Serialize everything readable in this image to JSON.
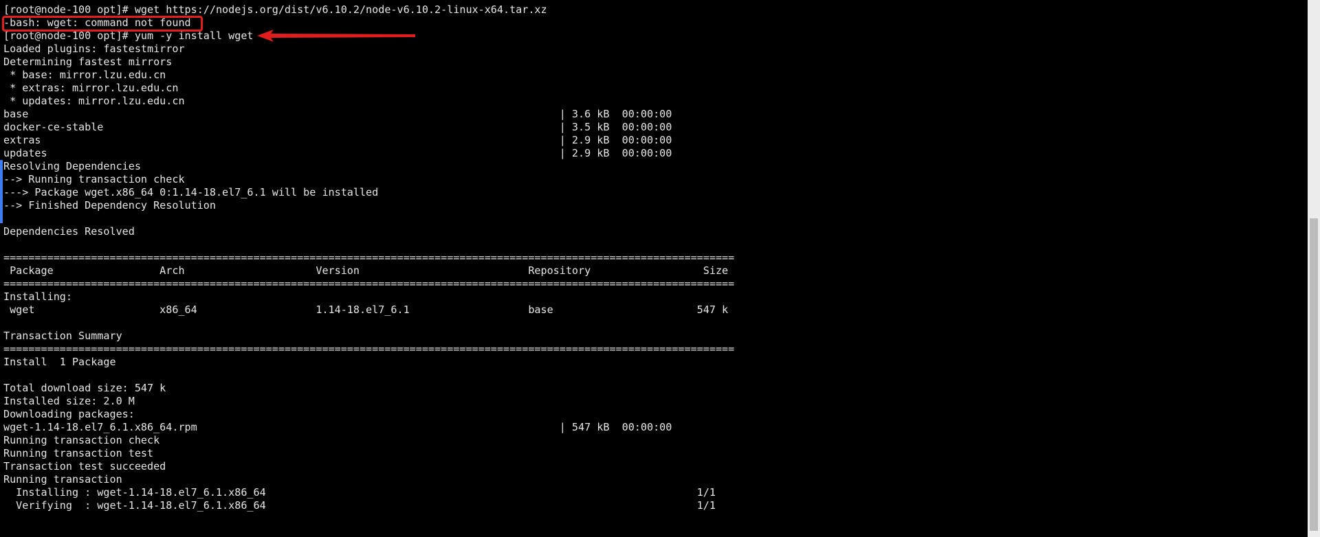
{
  "terminal": {
    "lines": [
      "[root@node-100 opt]# wget https://nodejs.org/dist/v6.10.2/node-v6.10.2-linux-x64.tar.xz",
      "-bash: wget: command not found",
      "[root@node-100 opt]# yum -y install wget",
      "Loaded plugins: fastestmirror",
      "Determining fastest mirrors",
      " * base: mirror.lzu.edu.cn",
      " * extras: mirror.lzu.edu.cn",
      " * updates: mirror.lzu.edu.cn",
      "base                                                                                     | 3.6 kB  00:00:00",
      "docker-ce-stable                                                                         | 3.5 kB  00:00:00",
      "extras                                                                                   | 2.9 kB  00:00:00",
      "updates                                                                                  | 2.9 kB  00:00:00",
      "Resolving Dependencies",
      "--> Running transaction check",
      "---> Package wget.x86_64 0:1.14-18.el7_6.1 will be installed",
      "--> Finished Dependency Resolution",
      "",
      "Dependencies Resolved",
      "",
      "=====================================================================================================================",
      " Package                 Arch                     Version                           Repository                  Size",
      "=====================================================================================================================",
      "Installing:",
      " wget                    x86_64                   1.14-18.el7_6.1                   base                       547 k",
      "",
      "Transaction Summary",
      "=====================================================================================================================",
      "Install  1 Package",
      "",
      "Total download size: 547 k",
      "Installed size: 2.0 M",
      "Downloading packages:",
      "wget-1.14-18.el7_6.1.x86_64.rpm                                                          | 547 kB  00:00:00",
      "Running transaction check",
      "Running transaction test",
      "Transaction test succeeded",
      "Running transaction",
      "  Installing : wget-1.14-18.el7_6.1.x86_64                                                                     1/1",
      "  Verifying  : wget-1.14-18.el7_6.1.x86_64                                                                     1/1"
    ]
  },
  "colors": {
    "background": "#000000",
    "text": "#e6e6e6",
    "annotation": "#e11d1d",
    "marker": "#3f7cf0",
    "scrollbar_track": "#ececec",
    "scrollbar_thumb": "#bcbcbc"
  }
}
